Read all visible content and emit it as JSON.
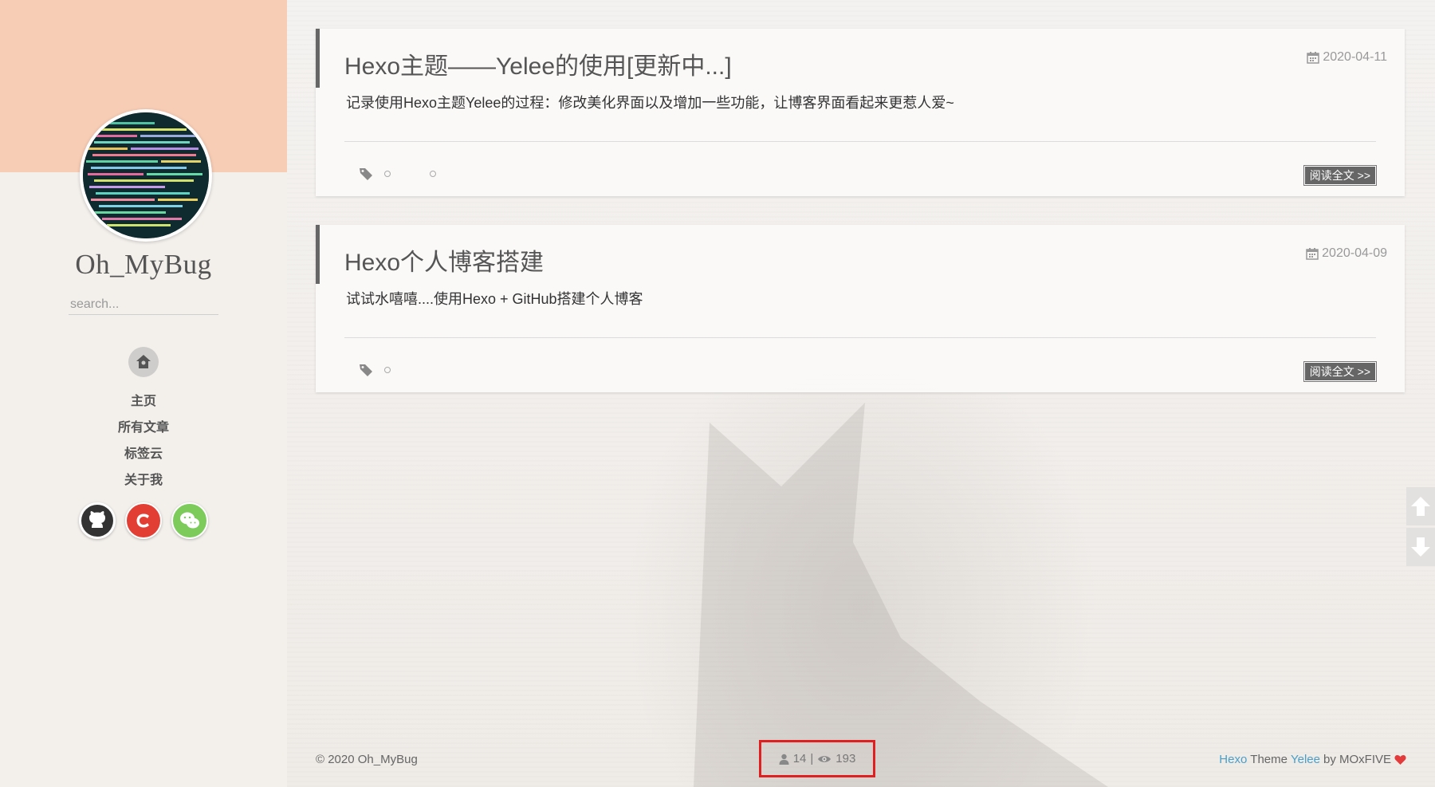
{
  "sidebar": {
    "site_name": "Oh_MyBug",
    "search_placeholder": "search...",
    "nav": [
      {
        "label": "主页"
      },
      {
        "label": "所有文章"
      },
      {
        "label": "标签云"
      },
      {
        "label": "关于我"
      }
    ],
    "social": [
      {
        "name": "github-icon",
        "color": "#333333"
      },
      {
        "name": "csdn-icon",
        "color": "#e33e33"
      },
      {
        "name": "wechat-icon",
        "color": "#7ccb5b"
      }
    ]
  },
  "posts": [
    {
      "title": "Hexo主题——Yelee的使用[更新中...]",
      "date": "2020-04-11",
      "excerpt": "记录使用Hexo主题Yelee的过程：修改美化界面以及增加一些功能，让博客界面看起来更惹人爱~",
      "read_more": "阅读全文 >>"
    },
    {
      "title": "Hexo个人博客搭建",
      "date": "2020-04-09",
      "excerpt": "试试水嘻嘻....使用Hexo + GitHub搭建个人博客",
      "read_more": "阅读全文 >>"
    }
  ],
  "footer": {
    "copyright": "© 2020 Oh_MyBug",
    "visitors": "14",
    "separator": "|",
    "views": "193",
    "credit_hexo": "Hexo",
    "credit_theme": "Theme",
    "credit_yelee": "Yelee",
    "credit_by": "by MOxFIVE"
  },
  "colors": {
    "sidebar_top": "#f8cdb5",
    "link": "#4a9fc9",
    "highlight_box": "#e02020",
    "heart": "#e33b3b"
  }
}
